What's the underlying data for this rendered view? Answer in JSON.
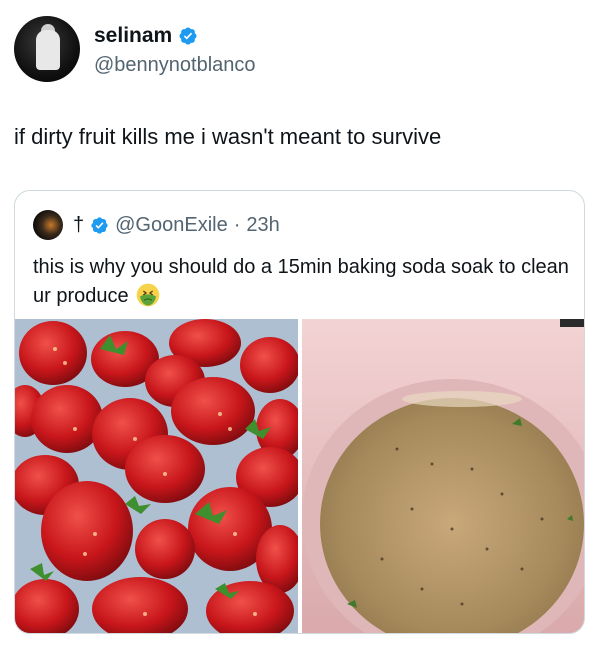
{
  "author": {
    "display_name": "selinam",
    "handle": "@bennynotblanco",
    "verified_color": "#1d9bf0"
  },
  "tweet": {
    "text": "if dirty fruit kills me i wasn't meant to survive"
  },
  "quoted": {
    "display_name": "†",
    "handle": "@GoonExile",
    "separator": "·",
    "time": "23h",
    "text": "this is why you should do a 15min baking soda soak to clean ur produce",
    "emoji_icon": "nauseated-face-icon"
  },
  "media": [
    {
      "description_icon": "strawberries-photo"
    },
    {
      "description_icon": "dirty-water-bowl-photo"
    }
  ]
}
